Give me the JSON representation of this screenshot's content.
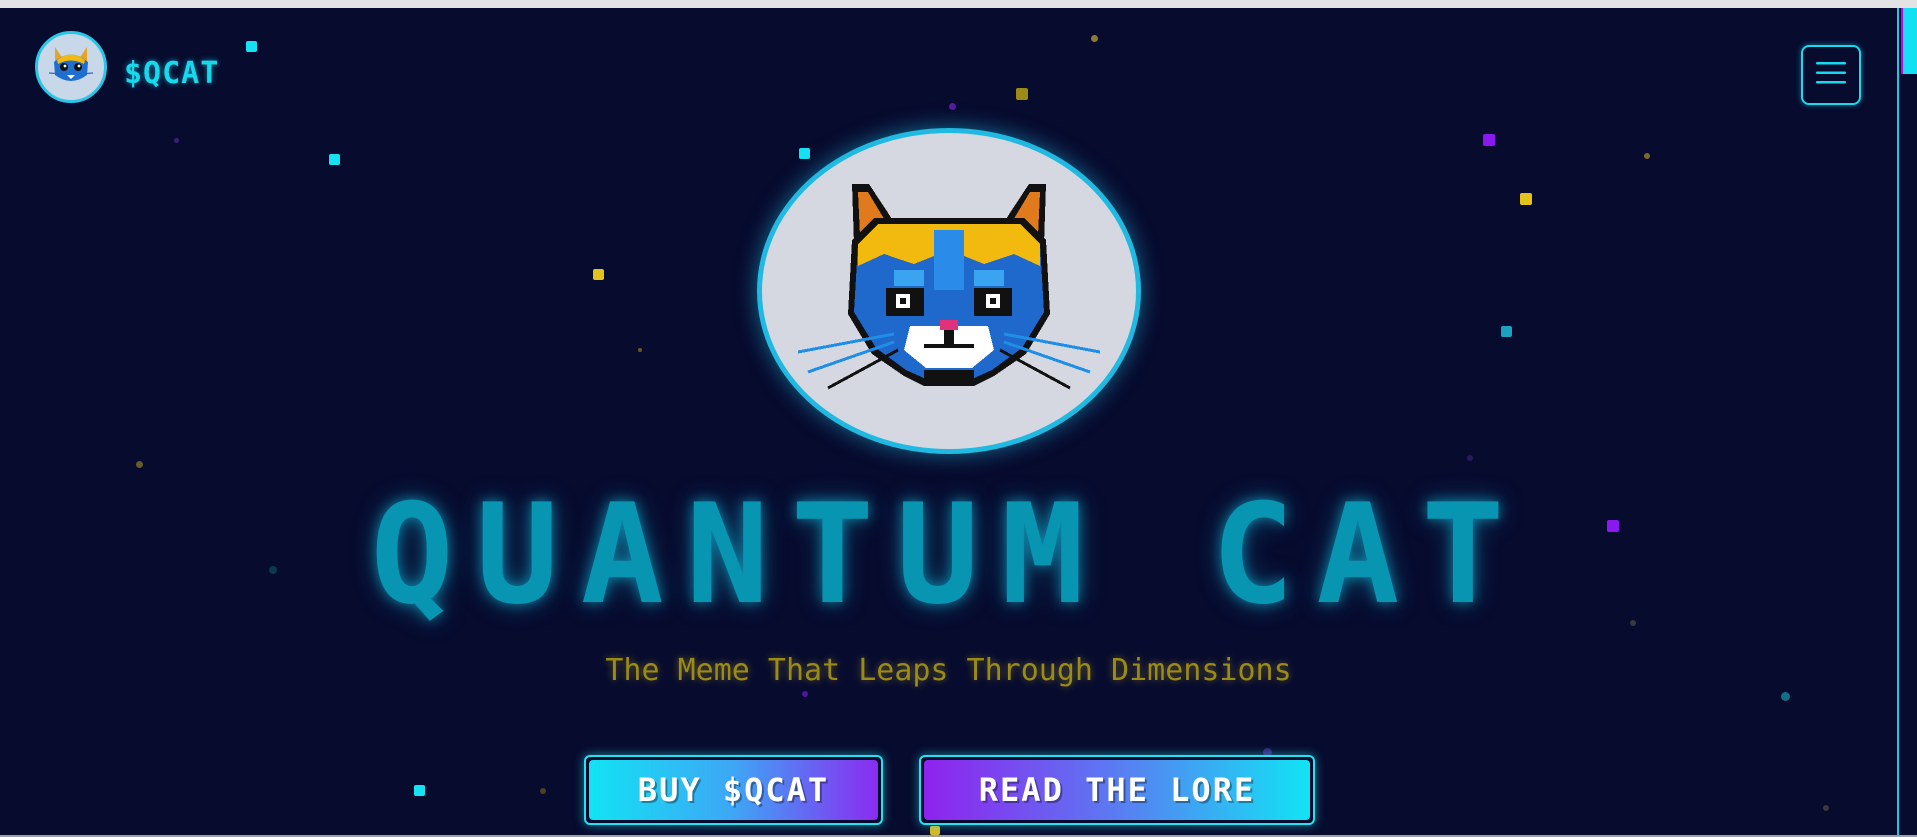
{
  "brand": {
    "name": "$QCAT",
    "logo_icon": "cat-logo-icon"
  },
  "menu": {
    "icon": "hamburger-menu-icon"
  },
  "hero": {
    "image_icon": "pixel-cat-icon",
    "title": "QUANTUM CAT",
    "subtitle": "The Meme That Leaps Through Dimensions"
  },
  "actions": {
    "buy_label": "BUY $QCAT",
    "lore_label": "READ THE LORE"
  },
  "colors": {
    "background": "#070b2e",
    "accent_cyan": "#13e0f2",
    "accent_purple": "#8f22ee",
    "accent_yellow": "#e2c828"
  }
}
